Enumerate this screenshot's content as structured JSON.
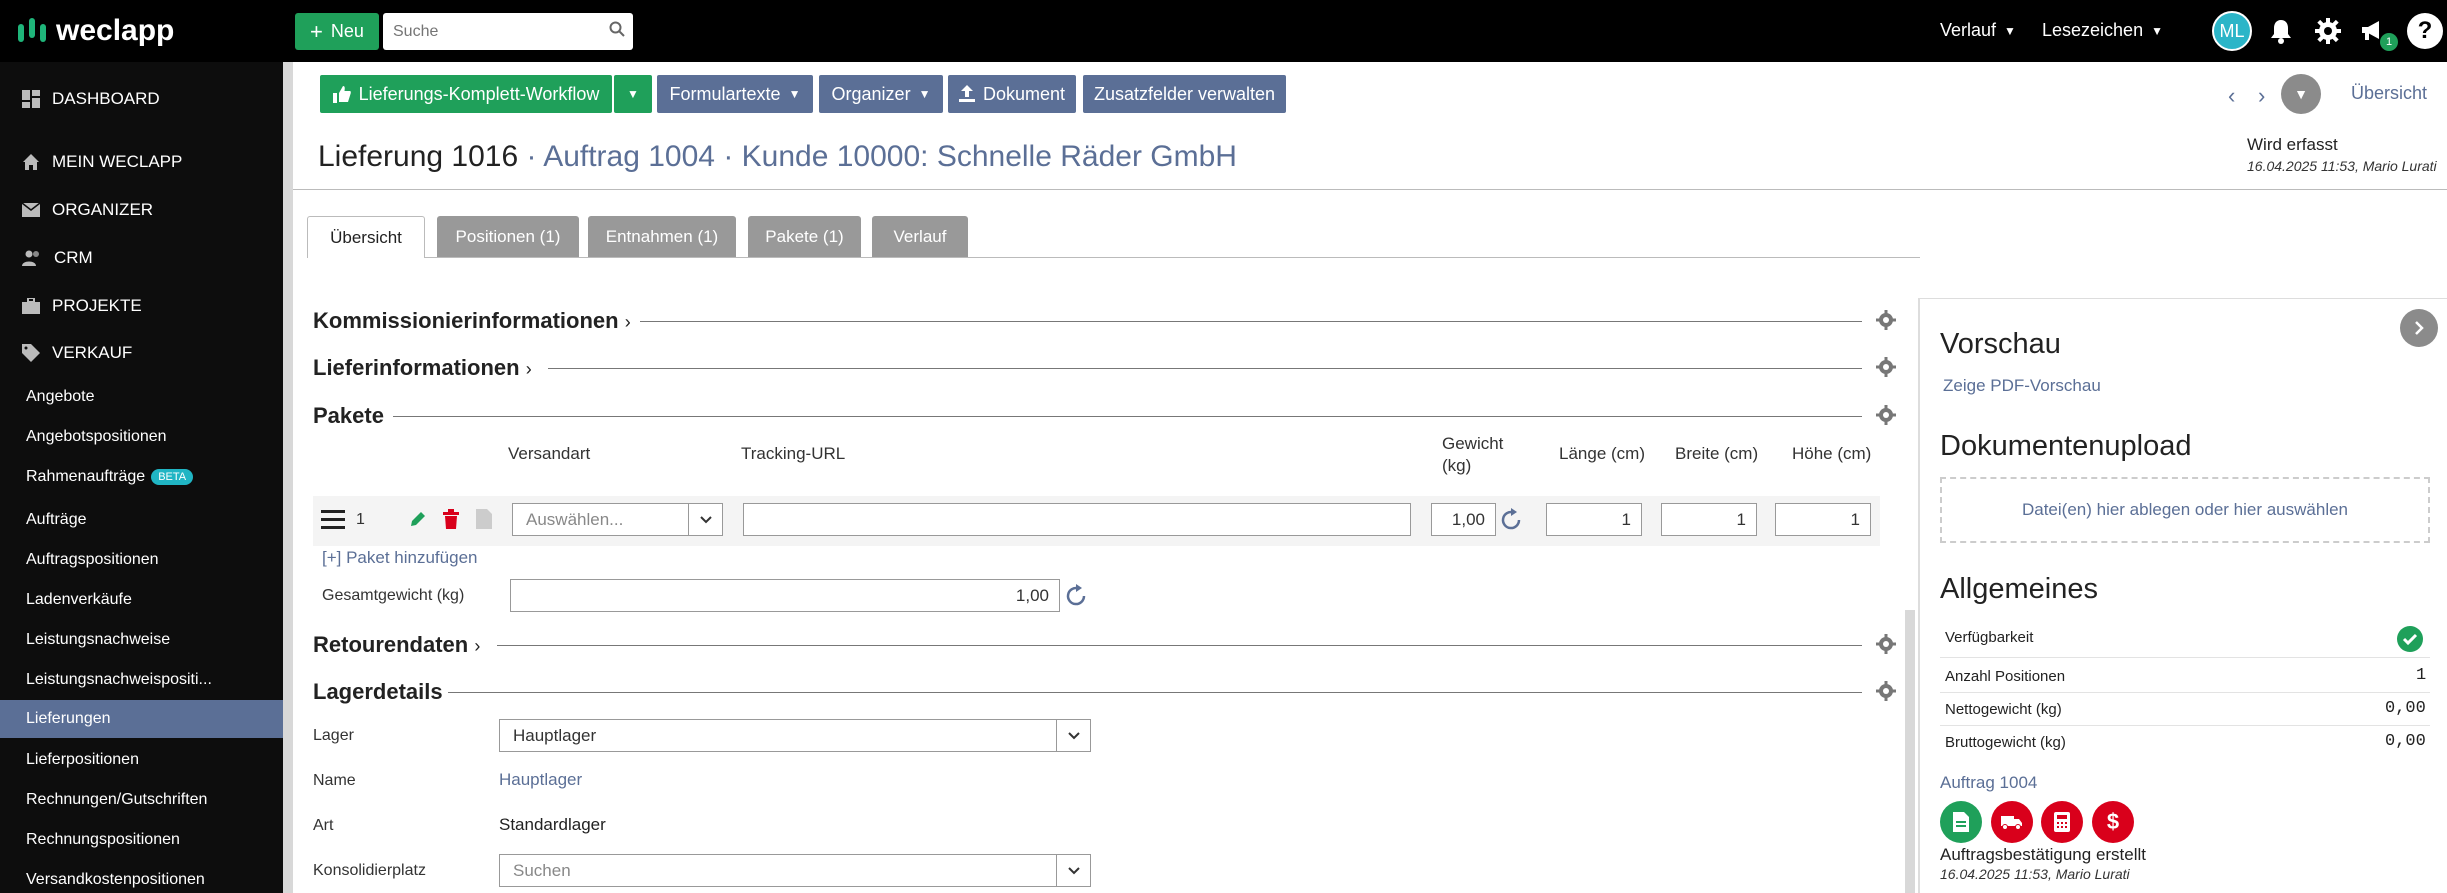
{
  "topbar": {
    "logo": "weclapp",
    "new_label": "Neu",
    "search_placeholder": "Suche",
    "verlauf": "Verlauf",
    "lesezeichen": "Lesezeichen",
    "avatar_initials": "ML",
    "announce_badge": "1",
    "help": "?"
  },
  "sidebar": {
    "dashboard": "DASHBOARD",
    "mein_weclapp": "MEIN WECLAPP",
    "organizer": "ORGANIZER",
    "crm": "CRM",
    "projekte": "PROJEKTE",
    "verkauf": "VERKAUF",
    "items": [
      "Angebote",
      "Angebotspositionen",
      "Rahmenaufträge",
      "Aufträge",
      "Auftragspositionen",
      "Ladenverkäufe",
      "Leistungsnachweise",
      "Leistungsnachweispositi...",
      "Lieferungen",
      "Lieferpositionen",
      "Rechnungen/Gutschriften",
      "Rechnungspositionen",
      "Versandkostenpositionen"
    ],
    "beta_label": "BETA"
  },
  "toolbar": {
    "workflow": "Lieferungs-Komplett-Workflow",
    "formulartexte": "Formulartexte",
    "organizer": "Organizer",
    "dokument": "Dokument",
    "zusatzfelder": "Zusatzfelder verwalten",
    "uebersicht_link": "Übersicht"
  },
  "header": {
    "title_main": "Lieferung 1016",
    "sep1": " · ",
    "auftrag": "Auftrag 1004",
    "sep2": " · ",
    "kunde": "Kunde 10000: Schnelle Räder GmbH",
    "status": "Wird erfasst",
    "status_meta": "16.04.2025 11:53, Mario Lurati"
  },
  "tabs": [
    "Übersicht",
    "Positionen (1)",
    "Entnahmen (1)",
    "Pakete (1)",
    "Verlauf"
  ],
  "sections": {
    "kommission": "Kommissionierinformationen",
    "lieferinfo": "Lieferinformationen",
    "pakete": "Pakete",
    "retouren": "Retourendaten",
    "lager": "Lagerdetails"
  },
  "pakete": {
    "col_versandart": "Versandart",
    "col_tracking": "Tracking-URL",
    "col_gewicht": "Gewicht (kg)",
    "col_laenge": "Länge (cm)",
    "col_breite": "Breite (cm)",
    "col_hoehe": "Höhe (cm)",
    "row_number": "1",
    "versandart_placeholder": "Auswählen...",
    "gewicht": "1,00",
    "laenge": "1",
    "breite": "1",
    "hoehe": "1",
    "add_link": "[+] Paket hinzufügen",
    "gesamt_label": "Gesamtgewicht (kg)",
    "gesamt_value": "1,00"
  },
  "lager": {
    "lager_label": "Lager",
    "lager_value": "Hauptlager",
    "name_label": "Name",
    "name_value": "Hauptlager",
    "art_label": "Art",
    "art_value": "Standardlager",
    "konsolidier_label": "Konsolidierplatz",
    "konsolidier_placeholder": "Suchen"
  },
  "right_panel": {
    "vorschau": "Vorschau",
    "pdf_link": "Zeige PDF-Vorschau",
    "upload_title": "Dokumentenupload",
    "dropzone": "Datei(en) hier ablegen oder hier auswählen",
    "allgemeines": "Allgemeines",
    "verfuegbarkeit": "Verfügbarkeit",
    "anzahl_label": "Anzahl Positionen",
    "anzahl_value": "1",
    "netto_label": "Nettogewicht (kg)",
    "netto_value": "0,00",
    "brutto_label": "Bruttogewicht (kg)",
    "brutto_value": "0,00",
    "auftrag_link": "Auftrag 1004",
    "event": "Auftragsbestätigung erstellt",
    "event_meta": "16.04.2025 11:53, Mario Lurati"
  },
  "colors": {
    "brand_green": "#1fa05a",
    "brand_blue": "#5b6f96",
    "danger_red": "#d9001b",
    "teal": "#20b5c4"
  }
}
